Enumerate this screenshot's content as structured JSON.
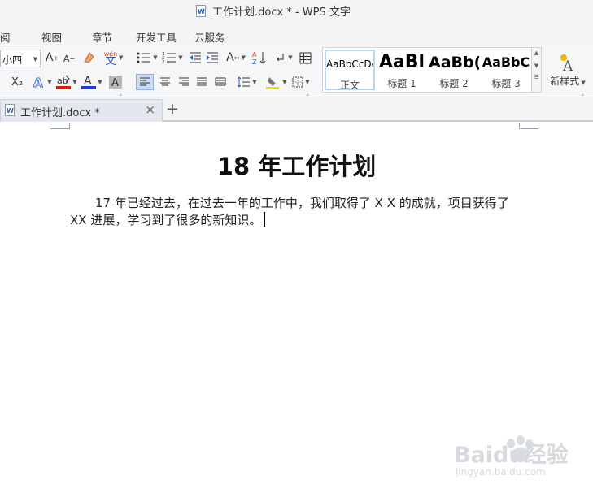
{
  "window": {
    "title": "工作计划.docx * - WPS 文字"
  },
  "menu": {
    "items": [
      "阅",
      "视图",
      "章节",
      "开发工具",
      "云服务"
    ]
  },
  "toolbar": {
    "font_size": "小四",
    "wen_label": "wén",
    "wen_char": "文",
    "subscript": "X₂",
    "highlight_color": "#e8e300",
    "font_color": "#1f3bd8",
    "underline_red": "#d81e06"
  },
  "styles": {
    "items": [
      {
        "sample": "AaBbCcDd",
        "name": "正文"
      },
      {
        "sample": "AaBl",
        "name": "标题 1"
      },
      {
        "sample": "AaBb(",
        "name": "标题 2"
      },
      {
        "sample": "AaBbC",
        "name": "标题 3"
      }
    ],
    "new_style": "新样式"
  },
  "tabs": {
    "doc_tab": "工作计划.docx *",
    "close": "×",
    "new": "+"
  },
  "document": {
    "heading": "18 年工作计划",
    "paragraph": "17 年已经过去，在过去一年的工作中，我们取得了 X X 的成就，项目获得了 XX 进展，学习到了很多的新知识。"
  },
  "watermark": {
    "brand": "Baidu经验",
    "url": "jingyan.baidu.com"
  }
}
